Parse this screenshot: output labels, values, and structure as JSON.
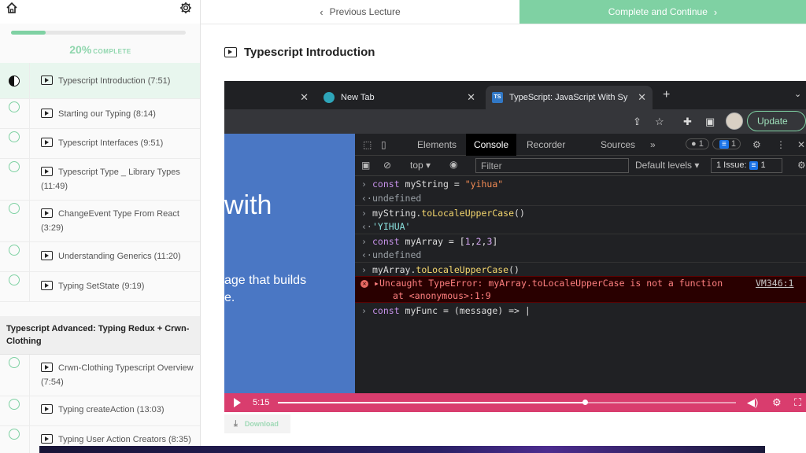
{
  "sidebar": {
    "progress_percent": 20,
    "progress_number": "20%",
    "progress_label": "COMPLETE",
    "lectures_top": [
      {
        "title": "Typescript Introduction (7:51)",
        "status": "in-progress"
      },
      {
        "title": "Starting our Typing (8:14)",
        "status": "incomplete"
      },
      {
        "title": "Typescript Interfaces (9:51)",
        "status": "incomplete"
      },
      {
        "title": "Typescript Type _ Library Types (11:49)",
        "status": "incomplete"
      },
      {
        "title": "ChangeEvent Type From React (3:29)",
        "status": "incomplete"
      },
      {
        "title": "Understanding Generics (11:20)",
        "status": "incomplete"
      },
      {
        "title": "Typing SetState (9:19)",
        "status": "incomplete"
      }
    ],
    "section_title": "Typescript Advanced: Typing Redux + Crwn-Clothing",
    "lectures_bottom": [
      {
        "title": "Crwn-Clothing Typescript Overview (7:54)",
        "status": "incomplete"
      },
      {
        "title": "Typing createAction (13:03)",
        "status": "incomplete"
      },
      {
        "title": "Typing User Action Creators (8:35)",
        "status": "incomplete"
      }
    ]
  },
  "topnav": {
    "prev_label": "Previous Lecture",
    "next_label": "Complete and Continue"
  },
  "main": {
    "lecture_title": "Typescript Introduction",
    "download_label": "Download"
  },
  "video": {
    "browser_tabs": [
      {
        "title": "",
        "active": false
      },
      {
        "title": "New Tab",
        "active": false
      },
      {
        "title": "TypeScript: JavaScript With Sy",
        "active": true
      }
    ],
    "update_label": "Update",
    "page_text_big": "with",
    "page_text_line1": "age that builds",
    "page_text_line2": "e.",
    "devtools_tabs": [
      "Elements",
      "Console",
      "Recorder",
      "Sources"
    ],
    "error_count": "1",
    "message_count": "1",
    "context_label": "top",
    "filter_placeholder": "Filter",
    "levels_label": "Default levels",
    "issues_label": "1 Issue:",
    "issues_count": "1",
    "console": {
      "l1": "const myString = \"yihua\"",
      "l2": "undefined",
      "l3": "myString.toLocaleUpperCase()",
      "l4": "'YIHUA'",
      "l5": "const myArray = [1,2,3]",
      "l6": "undefined",
      "l7": "myArray.toLocaleUpperCase()",
      "err1": "Uncaught TypeError: myArray.toLocaleUpperCase is not a function",
      "err2": "at <anonymous>:1:9",
      "err_source": "VM346:1",
      "l8": "const myFunc = (message) => |"
    },
    "current_time": "5:15",
    "played_fraction": 0.67
  },
  "colors": {
    "accent_green": "#7fd1a3",
    "player_bar": "#d93d6e",
    "ts_blue": "#4a77c4"
  }
}
